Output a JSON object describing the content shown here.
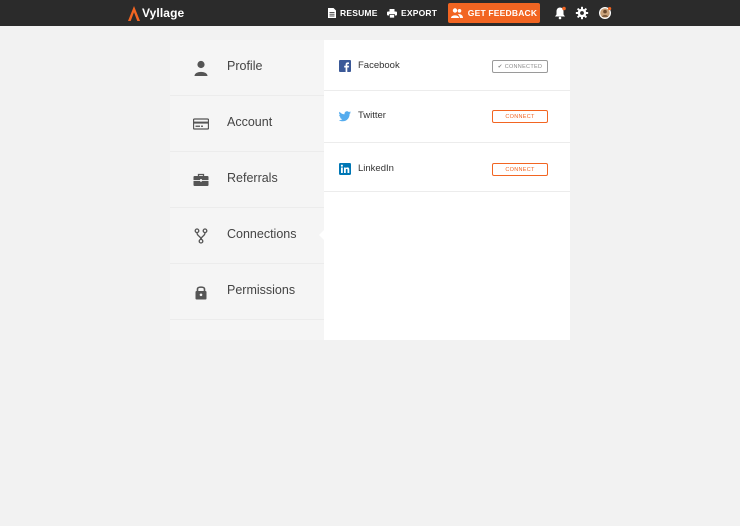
{
  "brand": {
    "name": "Vyllage",
    "accent": "#f26522"
  },
  "topbar": {
    "resume_label": "RESUME",
    "export_label": "EXPORT",
    "feedback_label": "GET FEEDBACK",
    "icons": [
      "notification-bell-icon",
      "settings-gear-icon",
      "user-avatar-icon"
    ]
  },
  "sidebar": {
    "items": [
      {
        "label": "Profile",
        "icon": "user-icon"
      },
      {
        "label": "Account",
        "icon": "credit-card-icon"
      },
      {
        "label": "Referrals",
        "icon": "briefcase-icon"
      },
      {
        "label": "Connections",
        "icon": "connections-icon",
        "active": true
      },
      {
        "label": "Permissions",
        "icon": "lock-icon"
      }
    ]
  },
  "connections": [
    {
      "name": "Facebook",
      "status_label": "CONNECTED",
      "connected": true,
      "icon": "facebook-icon"
    },
    {
      "name": "Twitter",
      "status_label": "CONNECT",
      "connected": false,
      "icon": "twitter-icon"
    },
    {
      "name": "LinkedIn",
      "status_label": "CONNECT",
      "connected": false,
      "icon": "linkedin-icon"
    }
  ]
}
